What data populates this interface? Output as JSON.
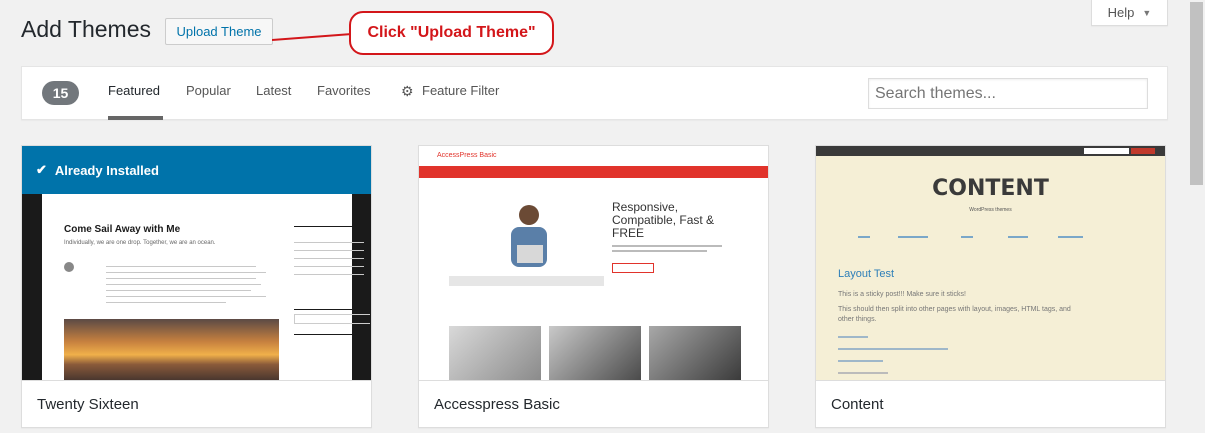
{
  "header": {
    "title": "Add Themes",
    "upload_button": "Upload Theme",
    "help_label": "Help"
  },
  "annotation": {
    "callout_text": "Click \"Upload Theme\"",
    "color": "#d3161a"
  },
  "filter_bar": {
    "count": "15",
    "tabs": [
      {
        "label": "Featured",
        "active": true
      },
      {
        "label": "Popular",
        "active": false
      },
      {
        "label": "Latest",
        "active": false
      },
      {
        "label": "Favorites",
        "active": false
      }
    ],
    "feature_filter": "Feature Filter",
    "search_placeholder": "Search themes..."
  },
  "themes": [
    {
      "name": "Twenty Sixteen",
      "installed_label": "Already Installed",
      "preview": {
        "site_title": "Come Sail Away with Me",
        "tagline": "Individually, we are one drop. Together, we are an ocean."
      }
    },
    {
      "name": "Accesspress Basic",
      "preview": {
        "logo": "AccessPress Basic",
        "headline": "Responsive, Compatible, Fast & FREE"
      }
    },
    {
      "name": "Content",
      "preview": {
        "site_title": "CONTENT",
        "tagline": "WordPress themes",
        "post_title": "Layout Test",
        "post_line1": "This is a sticky post!!! Make sure it sticks!",
        "post_line2": "This should then split into other pages with layout, images, HTML tags, and",
        "post_line3": "other things."
      }
    }
  ],
  "colors": {
    "accent": "#0073aa",
    "accesspress_red": "#e1332b",
    "count_badge": "#72777c"
  }
}
